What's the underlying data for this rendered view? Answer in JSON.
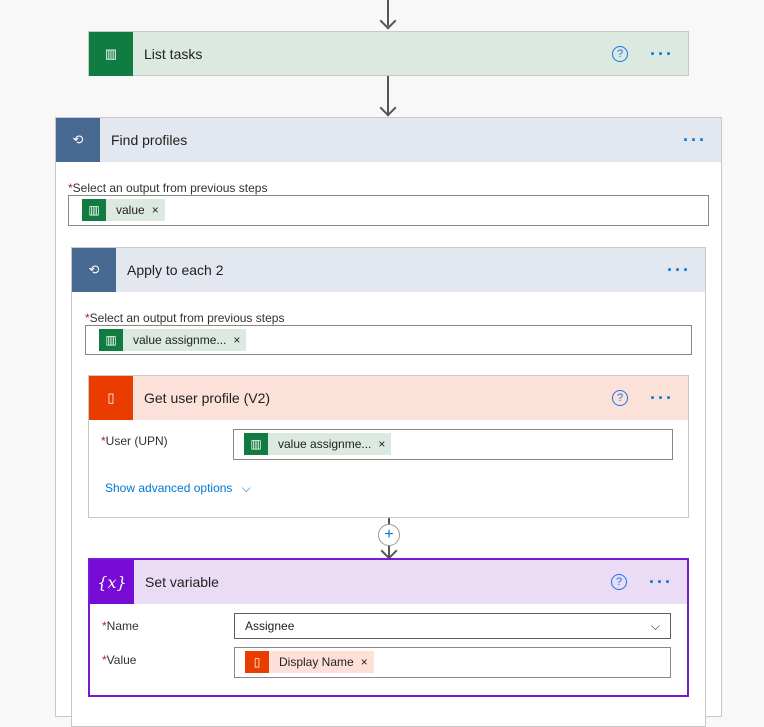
{
  "list_tasks": {
    "title": "List tasks",
    "icon": "planner-icon",
    "color": "#107c41"
  },
  "find_profiles": {
    "title": "Find profiles",
    "icon": "loop-icon",
    "color": "#486991",
    "field_label": "Select an output from previous steps",
    "token": "value"
  },
  "apply_each": {
    "title": "Apply to each 2",
    "icon": "loop-icon",
    "field_label": "Select an output from previous steps",
    "token": "value assignme..."
  },
  "get_profile": {
    "title": "Get user profile (V2)",
    "icon": "office-icon",
    "color": "#eb3c00",
    "user_label": "User (UPN)",
    "token": "value assignme...",
    "advanced": "Show advanced options"
  },
  "set_variable": {
    "title": "Set variable",
    "icon": "variable-icon",
    "color": "#770bd6",
    "name_label": "Name",
    "name_value": "Assignee",
    "value_label": "Value",
    "value_token": "Display Name"
  },
  "common": {
    "required": "*",
    "help": "?",
    "more": "···",
    "remove": "×"
  }
}
